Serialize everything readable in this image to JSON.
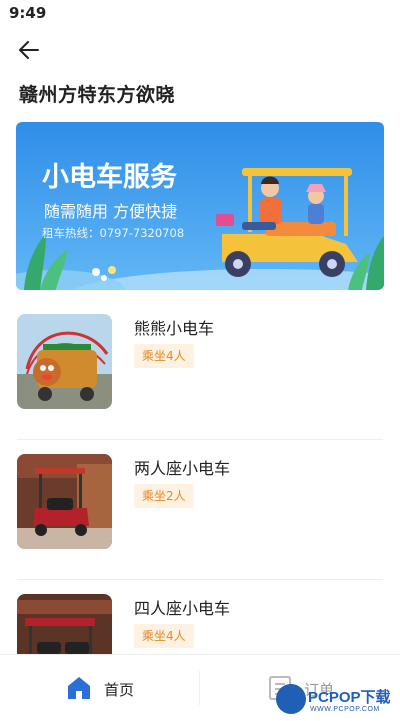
{
  "status_bar": {
    "time": "9:49"
  },
  "header": {
    "store_name": "赣州方特东方欲晓"
  },
  "banner": {
    "title": "小电车服务",
    "subtitle": "随需随用  方便快捷",
    "hotline": "租车热线：0797-7320708"
  },
  "items": [
    {
      "name": "熊熊小电车",
      "capacity": "乘坐4人"
    },
    {
      "name": "两人座小电车",
      "capacity": "乘坐2人"
    },
    {
      "name": "四人座小电车",
      "capacity": "乘坐4人"
    }
  ],
  "tabs": {
    "home": "首页",
    "orders": "订单"
  },
  "watermark": {
    "text": "PCPOP下载",
    "sub": "WWW.PCPOP.COM"
  },
  "colors": {
    "banner_blue": "#2f8ee8",
    "badge_text": "#e48a22",
    "badge_bg": "#fdf1e2",
    "home_icon": "#2b6fd6"
  },
  "icons": {
    "back": "arrow-left",
    "home": "house",
    "orders": "document"
  }
}
